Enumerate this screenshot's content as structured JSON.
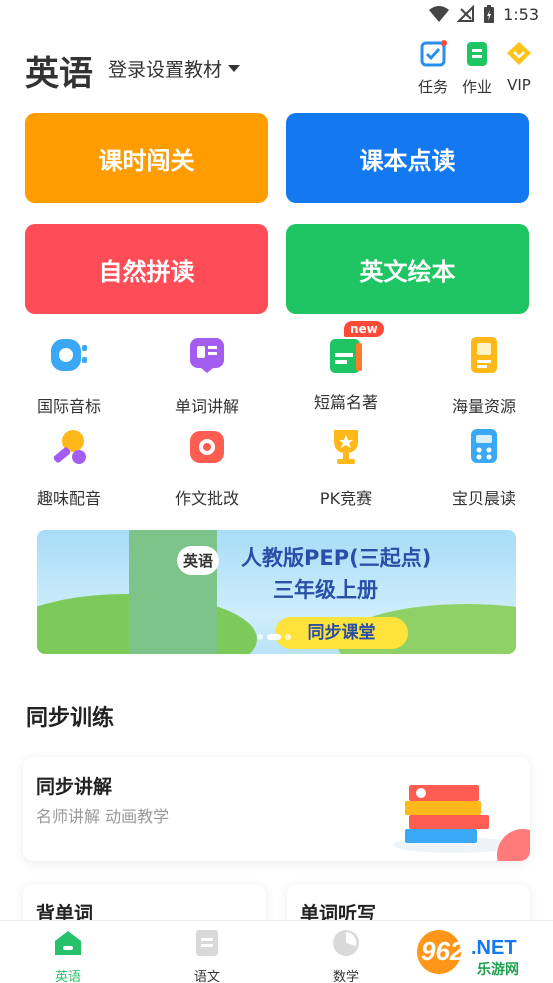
{
  "status_bar": {
    "time": "1:53"
  },
  "header": {
    "subject": "英语",
    "login_setting": "登录设置教材",
    "tasks_label": "任务",
    "homework_label": "作业",
    "vip_label": "VIP"
  },
  "tiles": [
    {
      "label": "课时闯关",
      "color": "#ff9c00"
    },
    {
      "label": "课本点读",
      "color": "#1479f0"
    },
    {
      "label": "自然拼读",
      "color": "#ff4d57"
    },
    {
      "label": "英文绘本",
      "color": "#1fc562"
    }
  ],
  "features": [
    {
      "label": "国际音标",
      "icon": "phonetic-icon"
    },
    {
      "label": "单词讲解",
      "icon": "word-explain-icon"
    },
    {
      "label": "短篇名著",
      "icon": "classics-icon",
      "badge": "new"
    },
    {
      "label": "海量资源",
      "icon": "resources-icon"
    },
    {
      "label": "趣味配音",
      "icon": "dubbing-icon"
    },
    {
      "label": "作文批改",
      "icon": "essay-icon"
    },
    {
      "label": "PK竞赛",
      "icon": "trophy-icon"
    },
    {
      "label": "宝贝晨读",
      "icon": "morning-read-icon"
    }
  ],
  "banner": {
    "book_title": "英语",
    "title": "人教版PEP(三起点)",
    "grade": "三年级上册",
    "button": "同步课堂"
  },
  "section": {
    "title": "同步训练",
    "cards": [
      {
        "title": "同步讲解",
        "subtitle": "名师讲解  动画教学"
      },
      {
        "title": "背单词"
      },
      {
        "title": "单词听写"
      }
    ]
  },
  "tabs": [
    {
      "label": "英语",
      "active": true
    },
    {
      "label": "语文",
      "active": false
    },
    {
      "label": "数学",
      "active": false
    }
  ],
  "watermark": {
    "number": "962",
    "suffix": ".NET",
    "sub": "乐游网"
  },
  "colors": {
    "accent": "#25c26b",
    "banner_text": "#2a4fa8"
  }
}
